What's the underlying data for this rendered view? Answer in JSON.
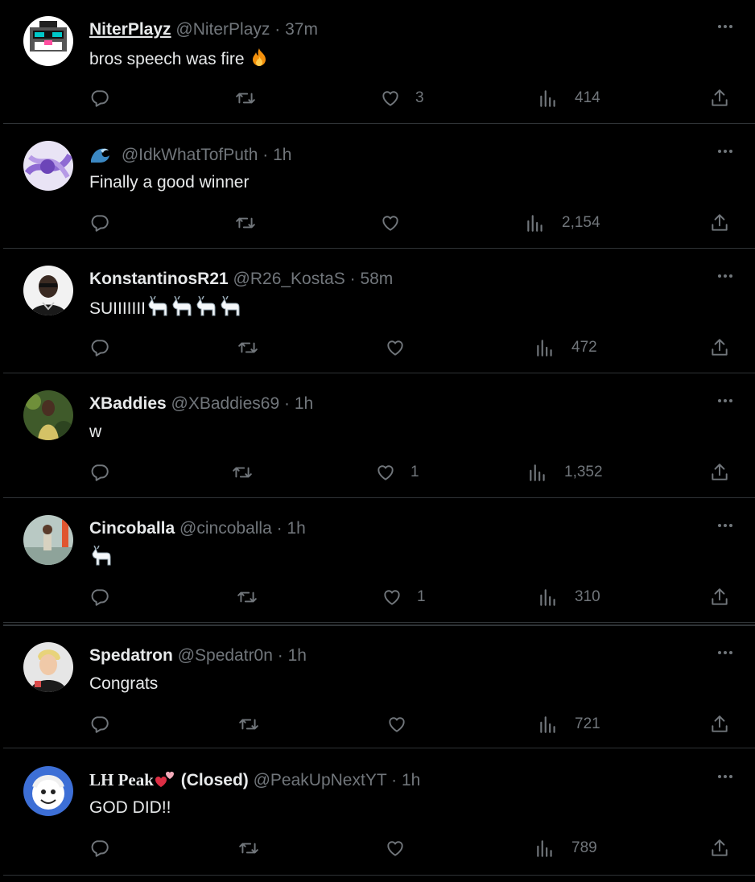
{
  "tweets": [
    {
      "name": "NiterPlayz",
      "handle": "@NiterPlayz",
      "dot": "·",
      "time": "37m",
      "text": "bros speech was fire",
      "text_emoji": "fire",
      "likes": "3",
      "views": "414"
    },
    {
      "name": "",
      "handle": "@IdkWhatTofPuth",
      "dot": "·",
      "time": "1h",
      "text": "Finally a good winner",
      "name_emoji": "wave",
      "likes": "",
      "views": "2,154"
    },
    {
      "name": "KonstantinosR21",
      "handle": "@R26_KostaS",
      "dot": "·",
      "time": "58m",
      "text": "SUIIIIIII",
      "text_emoji": "goat x4",
      "likes": "",
      "views": "472"
    },
    {
      "name": "XBaddies",
      "handle": "@XBaddies69",
      "dot": "·",
      "time": "1h",
      "text": "w",
      "likes": "1",
      "views": "1,352"
    },
    {
      "name": "Cincoballa",
      "handle": "@cincoballa",
      "dot": "·",
      "time": "1h",
      "text": "",
      "text_emoji": "goat",
      "likes": "1",
      "views": "310"
    },
    {
      "name": "Spedatron",
      "handle": "@Spedatr0n",
      "dot": "·",
      "time": "1h",
      "text": "Congrats",
      "likes": "",
      "views": "721"
    },
    {
      "name": "LH Peak",
      "name_suffix": "(Closed)",
      "name_emoji": "two-hearts",
      "handle": "@PeakUpNextYT",
      "dot": "·",
      "time": "1h",
      "text": "GOD DID!!",
      "likes": "",
      "views": "789"
    }
  ],
  "colors": {
    "background": "#000000",
    "text": "#e7e9ea",
    "muted": "#71767b",
    "divider": "#2f3336"
  },
  "icons": [
    "reply-icon",
    "retweet-icon",
    "like-icon",
    "views-icon",
    "share-icon",
    "more-icon"
  ]
}
